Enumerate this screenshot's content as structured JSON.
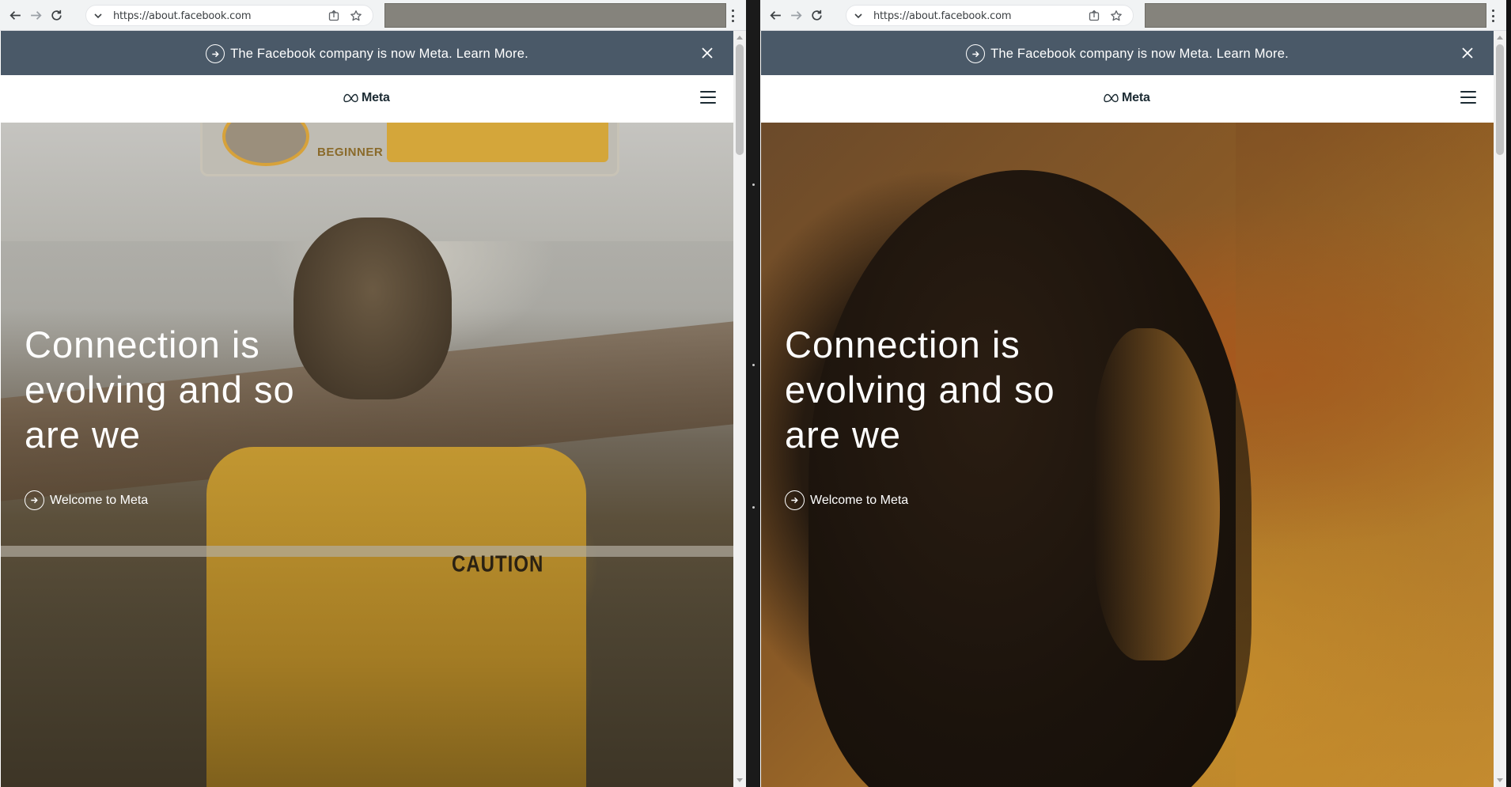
{
  "windows": [
    {
      "id": "left",
      "address_bar": {
        "url": "https://about.facebook.com"
      },
      "banner": {
        "text": "The Facebook company is now Meta. Learn More."
      },
      "header": {
        "logo_text": "Meta"
      },
      "hero": {
        "title": "Connection is evolving and so are we",
        "link_text": "Welcome to Meta",
        "video_overlay_texts": [
          "BEGINNER",
          "CAUTION"
        ]
      }
    },
    {
      "id": "right",
      "address_bar": {
        "url": "https://about.facebook.com"
      },
      "banner": {
        "text": "The Facebook company is now Meta. Learn More."
      },
      "header": {
        "logo_text": "Meta"
      },
      "hero": {
        "title": "Connection is evolving and so are we",
        "link_text": "Welcome to Meta"
      }
    }
  ],
  "icons": {
    "back": "arrow-left-icon",
    "forward": "arrow-right-icon",
    "reload": "reload-icon",
    "site_info": "chevron-down-icon",
    "share": "share-icon",
    "bookmark": "star-icon",
    "menu": "kebab-menu-icon",
    "banner_arrow": "arrow-circle-icon",
    "banner_close": "close-icon",
    "logo": "meta-infinity-icon",
    "nav_menu": "hamburger-icon",
    "hero_arrow": "arrow-circle-icon"
  },
  "colors": {
    "banner_bg": "#4a5968",
    "header_text": "#1c2b33",
    "browser_toolbar": "#f1f3f4",
    "extension_bar": "#85837c"
  }
}
